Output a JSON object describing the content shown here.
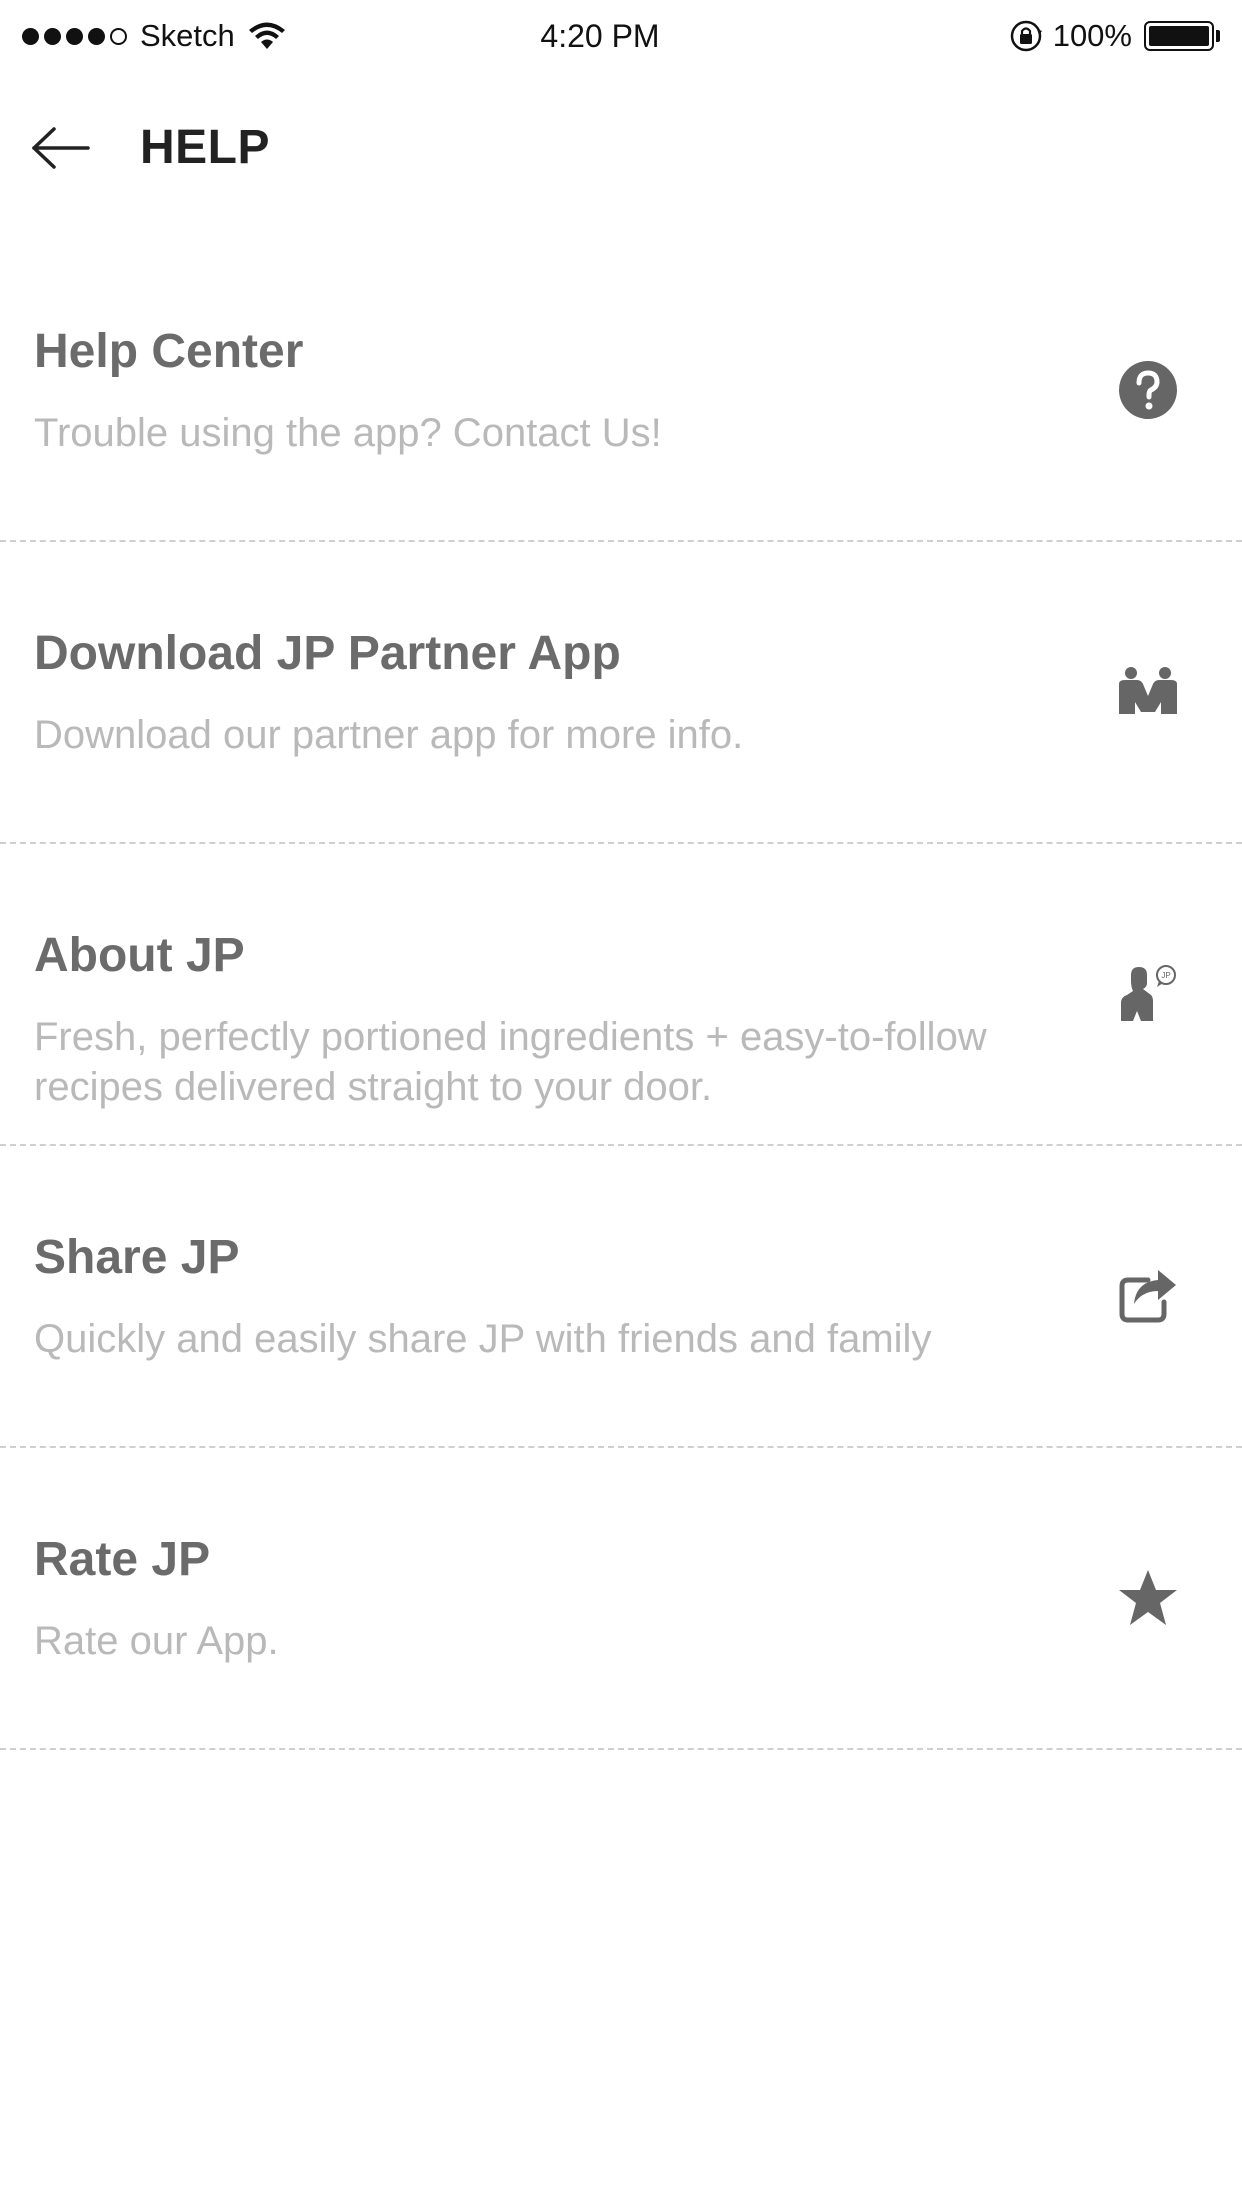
{
  "status_bar": {
    "carrier": "Sketch",
    "time": "4:20 PM",
    "battery": "100%",
    "signal_icon": "signal-dots-icon",
    "wifi_icon": "wifi-icon",
    "lock_icon": "rotation-lock-icon",
    "battery_icon": "battery-icon"
  },
  "header": {
    "title": "HELP",
    "back_icon": "arrow-left-icon"
  },
  "items": [
    {
      "title": "Help Center",
      "subtitle": "Trouble using the app? Contact Us!",
      "icon": "question-circle-icon"
    },
    {
      "title": "Download JP Partner App",
      "subtitle": "Download our partner app for more info.",
      "icon": "partners-icon"
    },
    {
      "title": "About JP",
      "subtitle": "Fresh, perfectly portioned ingredients + easy-to-follow recipes delivered straight to your door.",
      "icon": "chef-jp-icon"
    },
    {
      "title": "Share JP",
      "subtitle": "Quickly and easily share JP with friends and family",
      "icon": "share-icon"
    },
    {
      "title": "Rate JP",
      "subtitle": "Rate our App.",
      "icon": "star-icon"
    }
  ],
  "colors": {
    "title": "#6b6b6b",
    "subtitle": "#b9b9b9",
    "icon": "#666666",
    "divider": "#cfcfcf",
    "header_text": "#222222"
  }
}
